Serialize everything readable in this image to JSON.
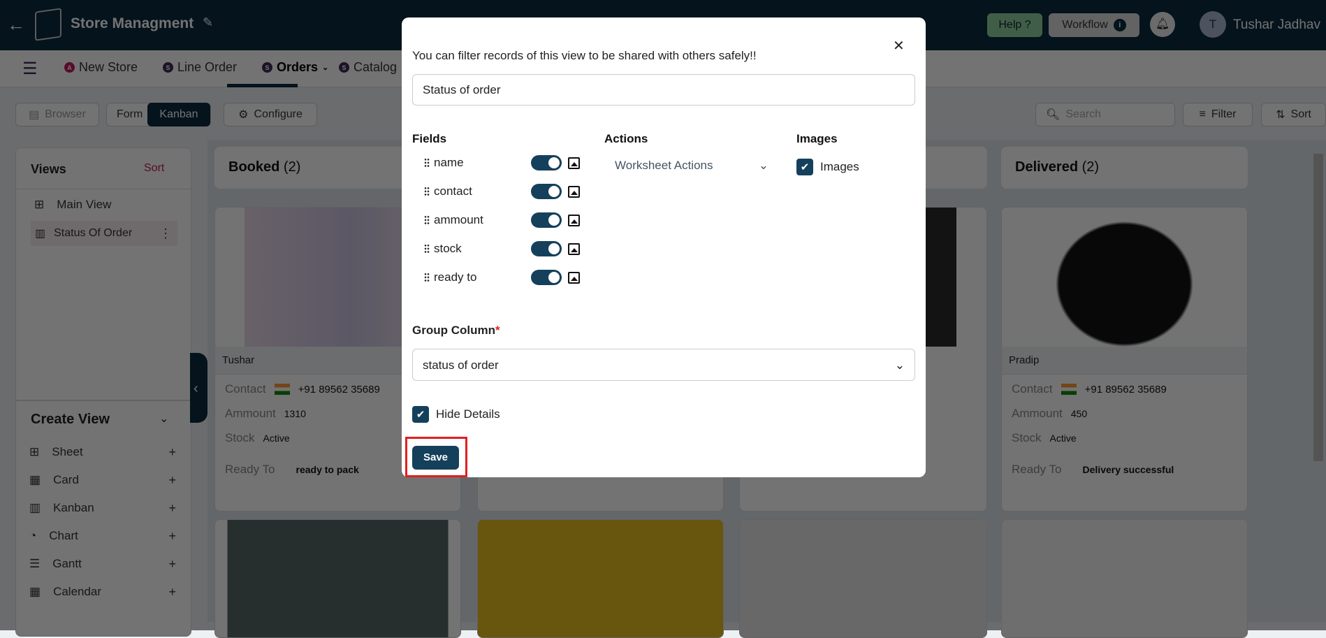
{
  "header": {
    "title": "Store Managment",
    "help": "Help ?",
    "workflow": "Workflow",
    "user_initial": "T",
    "user_name": "Tushar Jadhav"
  },
  "tabs": [
    {
      "badge": "A",
      "label": "New Store",
      "color": "#c2185b"
    },
    {
      "badge": "S",
      "label": "Line Order"
    },
    {
      "badge": "S",
      "label": "Orders",
      "active": true
    },
    {
      "badge": "S",
      "label": "Catalog"
    }
  ],
  "toolbar": {
    "browser": "Browser",
    "form": "Form",
    "kanban": "Kanban",
    "configure": "Configure",
    "search_placeholder": "Search",
    "filter": "Filter",
    "sort": "Sort"
  },
  "sidebar": {
    "views_title": "Views",
    "sort": "Sort",
    "views": [
      "Main View",
      "Status Of Order"
    ],
    "create_title": "Create View",
    "create_items": [
      "Sheet",
      "Card",
      "Kanban",
      "Chart",
      "Gantt",
      "Calendar"
    ]
  },
  "board": {
    "columns": [
      {
        "title": "Booked",
        "count": "(2)"
      },
      {
        "title": "Delivered",
        "count": "(2)"
      }
    ],
    "cards": [
      {
        "name": "Tushar",
        "contact_label": "Contact",
        "contact": "+91 89562 35689",
        "amount_label": "Ammount",
        "amount": "1310",
        "stock_label": "Stock",
        "stock": "Active",
        "ready_label": "Ready To",
        "ready": "ready to pack"
      },
      {
        "name": "Pradip",
        "contact_label": "Contact",
        "contact": "+91 89562 35689",
        "amount_label": "Ammount",
        "amount": "450",
        "stock_label": "Stock",
        "stock": "Active",
        "ready_label": "Ready To",
        "ready": "Delivery successful"
      }
    ]
  },
  "modal": {
    "message": "You can filter records of this view to be shared with others safely!!",
    "view_name": "Status of order",
    "fields_title": "Fields",
    "fields": [
      "name",
      "contact",
      "ammount",
      "stock",
      "ready to"
    ],
    "actions_title": "Actions",
    "actions_value": "Worksheet Actions",
    "images_title": "Images",
    "images_label": "Images",
    "images_checked": true,
    "group_label": "Group Column",
    "required_mark": "*",
    "group_value": "status of order",
    "hide_details": "Hide Details",
    "hide_checked": true,
    "save": "Save"
  },
  "colors": {
    "navy": "#0a2a3e",
    "accent": "#15405c",
    "highlight": "#e02020"
  }
}
